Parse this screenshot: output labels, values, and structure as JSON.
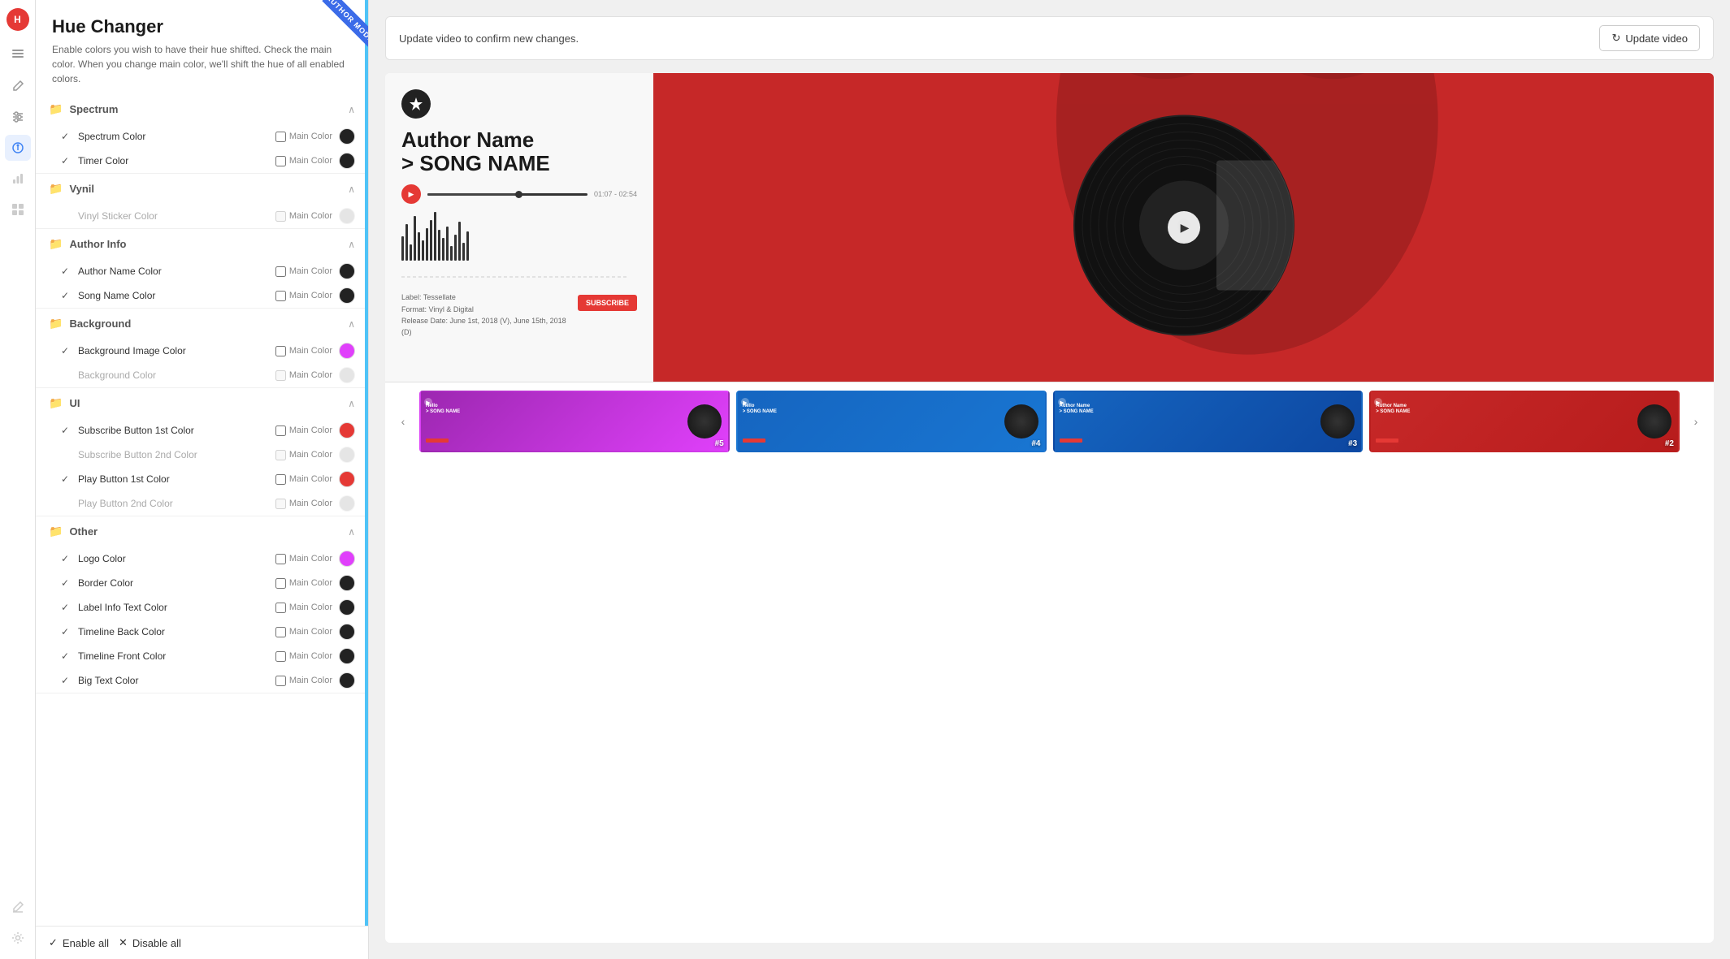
{
  "app": {
    "logo_initials": "H",
    "title": "Hue Changer",
    "description": "Enable colors you wish to have their hue shifted. Check the main color. When you change main color, we'll shift the hue of all enabled colors.",
    "author_mode_label": "AUTHOR MODE"
  },
  "panel_footer": {
    "enable_all_label": "Enable all",
    "disable_all_label": "Disable all"
  },
  "sections": [
    {
      "id": "spectrum",
      "label": "Spectrum",
      "expanded": true,
      "items": [
        {
          "id": "spectrum-color",
          "label": "Spectrum Color",
          "checked": true,
          "main_color": false,
          "color": "#222222",
          "disabled": false
        },
        {
          "id": "timer-color",
          "label": "Timer Color",
          "checked": true,
          "main_color": false,
          "color": "#222222",
          "disabled": false
        }
      ]
    },
    {
      "id": "vynil",
      "label": "Vynil",
      "expanded": true,
      "items": [
        {
          "id": "vinyl-sticker-color",
          "label": "Vinyl Sticker Color",
          "checked": false,
          "main_color": false,
          "color": "#aaaaaa",
          "disabled": true
        }
      ]
    },
    {
      "id": "author-info",
      "label": "Author Info",
      "expanded": true,
      "items": [
        {
          "id": "author-name-color",
          "label": "Author Name Color",
          "checked": true,
          "main_color": false,
          "color": "#222222",
          "disabled": false
        },
        {
          "id": "song-name-color",
          "label": "Song Name Color",
          "checked": true,
          "main_color": false,
          "color": "#222222",
          "disabled": false
        }
      ]
    },
    {
      "id": "background",
      "label": "Background",
      "expanded": true,
      "items": [
        {
          "id": "bg-image-color",
          "label": "Background Image Color",
          "checked": true,
          "main_color": false,
          "color": "#e040fb",
          "disabled": false
        },
        {
          "id": "bg-color",
          "label": "Background Color",
          "checked": false,
          "main_color": false,
          "color": "#aaaaaa",
          "disabled": true
        }
      ]
    },
    {
      "id": "ui",
      "label": "UI",
      "expanded": true,
      "items": [
        {
          "id": "subscribe-btn-1-color",
          "label": "Subscribe Button 1st Color",
          "checked": true,
          "main_color": false,
          "color": "#e53935",
          "disabled": false
        },
        {
          "id": "subscribe-btn-2-color",
          "label": "Subscribe Button 2nd Color",
          "checked": false,
          "main_color": false,
          "color": "#aaaaaa",
          "disabled": true
        },
        {
          "id": "play-btn-1-color",
          "label": "Play Button 1st Color",
          "checked": true,
          "main_color": false,
          "color": "#e53935",
          "disabled": false
        },
        {
          "id": "play-btn-2-color",
          "label": "Play Button 2nd Color",
          "checked": false,
          "main_color": false,
          "color": "#aaaaaa",
          "disabled": true
        }
      ]
    },
    {
      "id": "other",
      "label": "Other",
      "expanded": true,
      "items": [
        {
          "id": "logo-color",
          "label": "Logo Color",
          "checked": true,
          "main_color": false,
          "color": "#e040fb",
          "disabled": false
        },
        {
          "id": "border-color",
          "label": "Border Color",
          "checked": true,
          "main_color": false,
          "color": "#222222",
          "disabled": false
        },
        {
          "id": "label-info-text-color",
          "label": "Label Info Text Color",
          "checked": true,
          "main_color": false,
          "color": "#222222",
          "disabled": false
        },
        {
          "id": "timeline-back-color",
          "label": "Timeline Back Color",
          "checked": true,
          "main_color": false,
          "color": "#222222",
          "disabled": false
        },
        {
          "id": "timeline-front-color",
          "label": "Timeline Front Color",
          "checked": true,
          "main_color": false,
          "color": "#222222",
          "disabled": false
        },
        {
          "id": "big-text-color",
          "label": "Big Text Color",
          "checked": true,
          "main_color": false,
          "color": "#222222",
          "disabled": false
        }
      ]
    }
  ],
  "main_color_label": "Main Color",
  "update_bar": {
    "text": "Update video to confirm new changes.",
    "button_label": "Update video"
  },
  "video_preview": {
    "author_name": "Author Name",
    "song_name": "> SONG NAME",
    "time_display": "01:07 - 02:54",
    "label": "Label: Tessellate",
    "format": "Format: Vinyl & Digital",
    "release": "Release Date: June 1st, 2018 (V), June 15th, 2018 (D)",
    "subscribe_label": "SUBSCRIBE",
    "play_icon": "▶"
  },
  "thumbnails": [
    {
      "number": "#5",
      "author": "Hello",
      "song": "> SONG NAME",
      "bg_color": "#9c27b0",
      "bg_color2": "#e040fb"
    },
    {
      "number": "#4",
      "author": "Hello",
      "song": "> SONG NAME",
      "bg_color": "#1565c0",
      "bg_color2": "#1976d2"
    },
    {
      "number": "#3",
      "author": "Author Name",
      "song": "> SONG NAME",
      "bg_color": "#1565c0",
      "bg_color2": "#0d47a1"
    },
    {
      "number": "#2",
      "author": "Author Name",
      "song": "> SONG NAME",
      "bg_color": "#c62828",
      "bg_color2": "#b71c1c"
    }
  ],
  "icons": {
    "folder": "📁",
    "chevron_up": "∧",
    "chevron_down": "∨",
    "check": "✓",
    "left_arrow": "‹",
    "right_arrow": "›",
    "refresh": "↻",
    "pencil": "✏",
    "layers": "⊞",
    "sliders": "≡",
    "paint": "🎨",
    "chart": "📊",
    "grid": "▦",
    "edit2": "✏",
    "shield": "🔒",
    "star": "★"
  },
  "sidebar_items": [
    "logo",
    "layers",
    "pencil",
    "sliders",
    "paint",
    "chart",
    "grid"
  ],
  "sidebar_bottom_items": [
    "edit-bottom",
    "settings-bottom"
  ]
}
